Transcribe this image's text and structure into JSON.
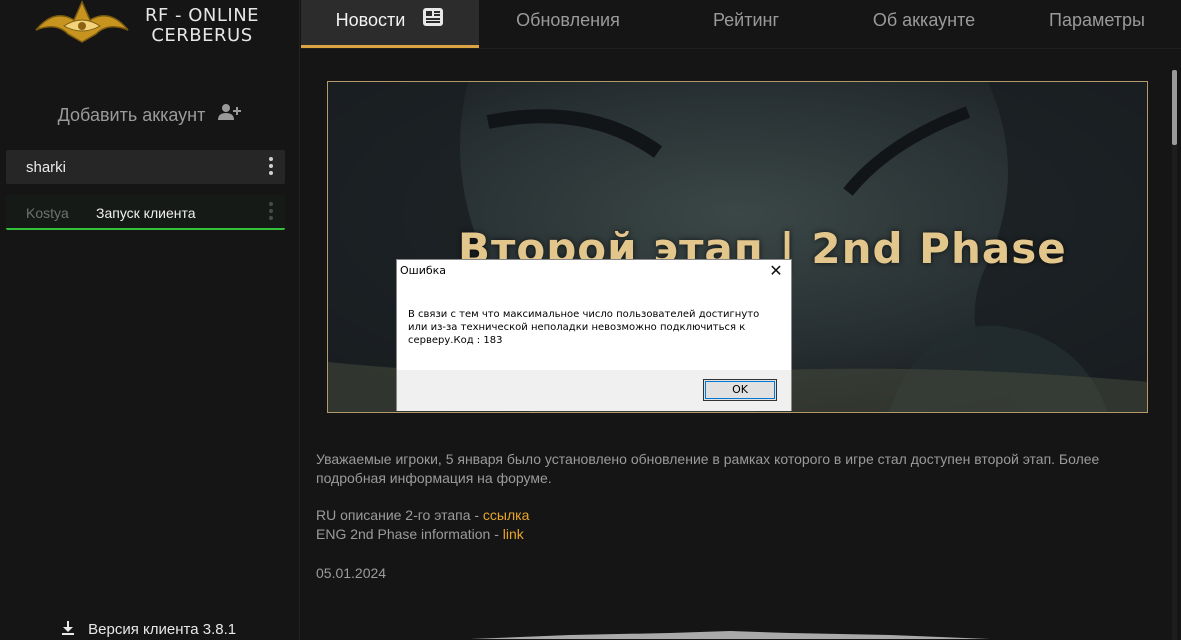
{
  "app": {
    "logo_line1": "RF - ONLINE",
    "logo_line2": "CERBERUS"
  },
  "sidebar": {
    "add_account_label": "Добавить аккаунт",
    "accounts": [
      {
        "name": "sharki"
      },
      {
        "name": "Kostya",
        "action": "Запуск клиента"
      }
    ],
    "version_label": "Версия клиента 3.8.1"
  },
  "nav": {
    "tabs": [
      {
        "label": "Новости",
        "active": true
      },
      {
        "label": "Обновления"
      },
      {
        "label": "Рейтинг"
      },
      {
        "label": "Об аккаунте"
      },
      {
        "label": "Параметры"
      }
    ]
  },
  "news": {
    "banner_title": "Второй этап | 2nd Phase",
    "body": "Уважаемые игроки, 5 января было установлено обновление в рамках которого в игре стал доступен второй этап. Более подробная информация на форуме.",
    "ru_prefix": "RU описание 2-го этапа - ",
    "ru_link": "ссылка",
    "eng_prefix": "ENG 2nd Phase information - ",
    "eng_link": "link",
    "date": "05.01.2024"
  },
  "dialog": {
    "title": "Ошибка",
    "close": "✕",
    "message": "В связи с тем что максимальное число пользователей достигнуто или из-за технической неполадки невозможно подключиться к серверу.Код : 183",
    "ok_label": "OK"
  },
  "colors": {
    "accent": "#d9a441",
    "link": "#e8a52a",
    "active_account_border": "#34c03a"
  }
}
